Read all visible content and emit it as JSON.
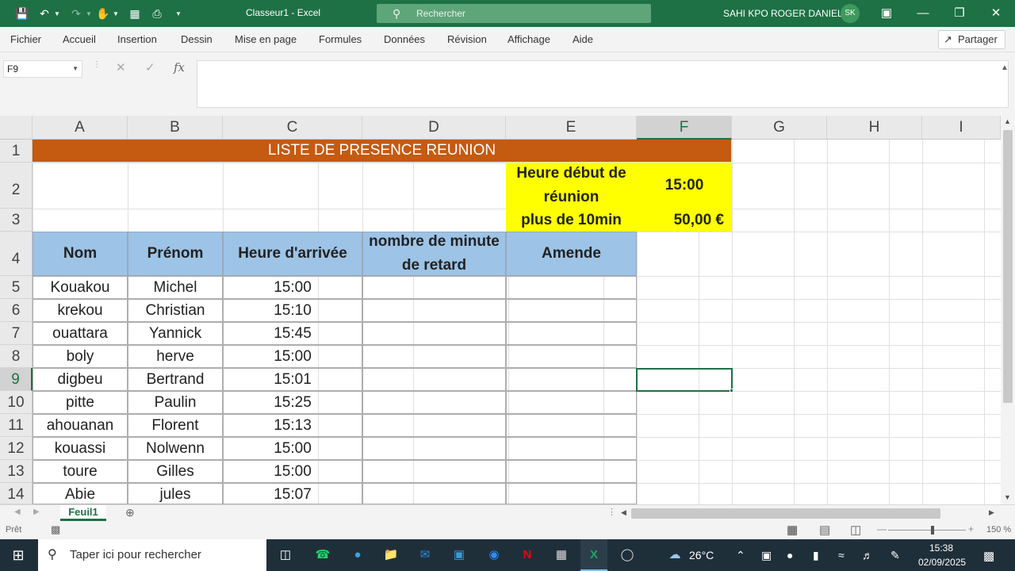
{
  "window": {
    "title": "Classeur1  -  Excel",
    "search_placeholder": "Rechercher",
    "user_name": "SAHI KPO ROGER DANIEL",
    "user_initials": "SK"
  },
  "ribbon": {
    "tabs": [
      "Fichier",
      "Accueil",
      "Insertion",
      "Dessin",
      "Mise en page",
      "Formules",
      "Données",
      "Révision",
      "Affichage",
      "Aide"
    ],
    "share_label": "Partager"
  },
  "formula_bar": {
    "name_box": "F9",
    "fx_label": "fx",
    "value": ""
  },
  "columns": [
    "A",
    "B",
    "C",
    "D",
    "E",
    "F",
    "G",
    "H",
    "I"
  ],
  "rows": [
    "1",
    "2",
    "3",
    "4",
    "5",
    "6",
    "7",
    "8",
    "9",
    "10",
    "11",
    "12",
    "13",
    "14"
  ],
  "sheet": {
    "title": "LISTE DE PRESENCE REUNION",
    "start_label": "Heure début de réunion",
    "start_value": "15:00",
    "late_label": "plus de 10min",
    "late_value": "50,00 €",
    "headers": [
      "Nom",
      "Prénom",
      "Heure d'arrivée",
      "nombre de minute de retard",
      "Amende"
    ],
    "records": [
      {
        "nom": "Kouakou",
        "prenom": "Michel",
        "heure": "15:00"
      },
      {
        "nom": "krekou",
        "prenom": "Christian",
        "heure": "15:10"
      },
      {
        "nom": "ouattara",
        "prenom": "Yannick",
        "heure": "15:45"
      },
      {
        "nom": "boly",
        "prenom": "herve",
        "heure": "15:00"
      },
      {
        "nom": "digbeu",
        "prenom": "Bertrand",
        "heure": "15:01"
      },
      {
        "nom": "pitte",
        "prenom": "Paulin",
        "heure": "15:25"
      },
      {
        "nom": "ahouanan",
        "prenom": "Florent",
        "heure": "15:13"
      },
      {
        "nom": "kouassi",
        "prenom": "Nolwenn",
        "heure": "15:00"
      },
      {
        "nom": "toure",
        "prenom": "Gilles",
        "heure": "15:00"
      },
      {
        "nom": "Abie",
        "prenom": "jules",
        "heure": "15:07"
      }
    ]
  },
  "sheet_tabs": [
    "Feuil1"
  ],
  "status": {
    "ready": "Prêt",
    "zoom": "150 %"
  },
  "taskbar": {
    "search_placeholder": "Taper ici pour rechercher",
    "weather": "26°C",
    "time": "15:38",
    "date": "02/09/2025"
  }
}
